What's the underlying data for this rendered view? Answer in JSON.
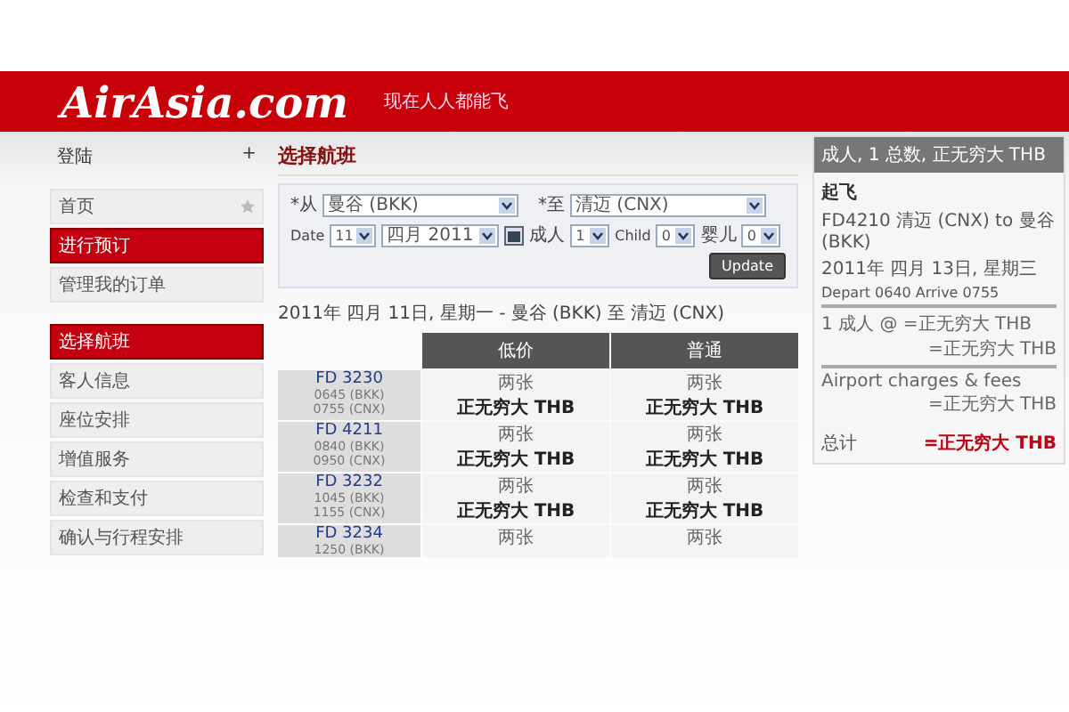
{
  "header": {
    "logo": "AirAsia.com",
    "tagline": "现在人人都能飞"
  },
  "sidebar": {
    "login": {
      "label": "登陆",
      "symbol": "+"
    },
    "menu": [
      {
        "label": "首页",
        "kind": "home",
        "selected": false
      },
      {
        "label": "进行预订",
        "kind": "link",
        "selected": true
      },
      {
        "label": "管理我的订单",
        "kind": "link",
        "selected": false
      }
    ],
    "steps": [
      {
        "label": "选择航班",
        "selected": true
      },
      {
        "label": "客人信息",
        "selected": false
      },
      {
        "label": "座位安排",
        "selected": false
      },
      {
        "label": "增值服务",
        "selected": false
      },
      {
        "label": "检查和支付",
        "selected": false
      },
      {
        "label": "确认与行程安排",
        "selected": false
      }
    ]
  },
  "main": {
    "title": "选择航班",
    "form": {
      "from": {
        "label": "*从",
        "value": "曼谷 (BKK)"
      },
      "to": {
        "label": "*至",
        "value": "清迈 (CNX)"
      },
      "date": {
        "label": "Date",
        "day": "11",
        "month": "四月 2011"
      },
      "adults": {
        "label": "成人",
        "value": "1"
      },
      "child": {
        "label": "Child",
        "value": "0"
      },
      "infant": {
        "label": "婴儿",
        "value": "0"
      },
      "update": "Update"
    },
    "date_line": "2011年 四月 11日, 星期一 - 曼谷 (BKK) 至 清迈 (CNX)",
    "table": {
      "columns": [
        "低价",
        "普通"
      ],
      "rows": [
        {
          "flight": "FD 3230",
          "depart": "0645 (BKK)",
          "arrive": "0755 (CNX)",
          "cells": [
            {
              "note": "两张",
              "price": "正无穷大 THB"
            },
            {
              "note": "两张",
              "price": "正无穷大 THB"
            }
          ]
        },
        {
          "flight": "FD 4211",
          "depart": "0840 (BKK)",
          "arrive": "0950 (CNX)",
          "cells": [
            {
              "note": "两张",
              "price": "正无穷大 THB"
            },
            {
              "note": "两张",
              "price": "正无穷大 THB"
            }
          ]
        },
        {
          "flight": "FD 3232",
          "depart": "1045 (BKK)",
          "arrive": "1155 (CNX)",
          "cells": [
            {
              "note": "两张",
              "price": "正无穷大 THB"
            },
            {
              "note": "两张",
              "price": "正无穷大 THB"
            }
          ]
        },
        {
          "flight": "FD 3234",
          "depart": "1250 (BKK)",
          "cells": [
            {
              "note": "两张"
            },
            {
              "note": "两张"
            }
          ]
        }
      ]
    }
  },
  "summary": {
    "header": "成人, 1 总数, 正无穷大 THB",
    "title": "起飞",
    "flight": "FD4210 清迈 (CNX) to 曼谷 (BKK)",
    "date": "2011年 四月 13日, 星期三",
    "times": "Depart 0640 Arrive 0755",
    "lines": [
      {
        "label": "1 成人 @ =正无穷大 THB",
        "amount": "=正无穷大 THB"
      },
      {
        "label": "Airport charges & fees",
        "amount": "=正无穷大 THB"
      }
    ],
    "total": {
      "label": "总计",
      "amount": "=正无穷大 THB"
    }
  }
}
